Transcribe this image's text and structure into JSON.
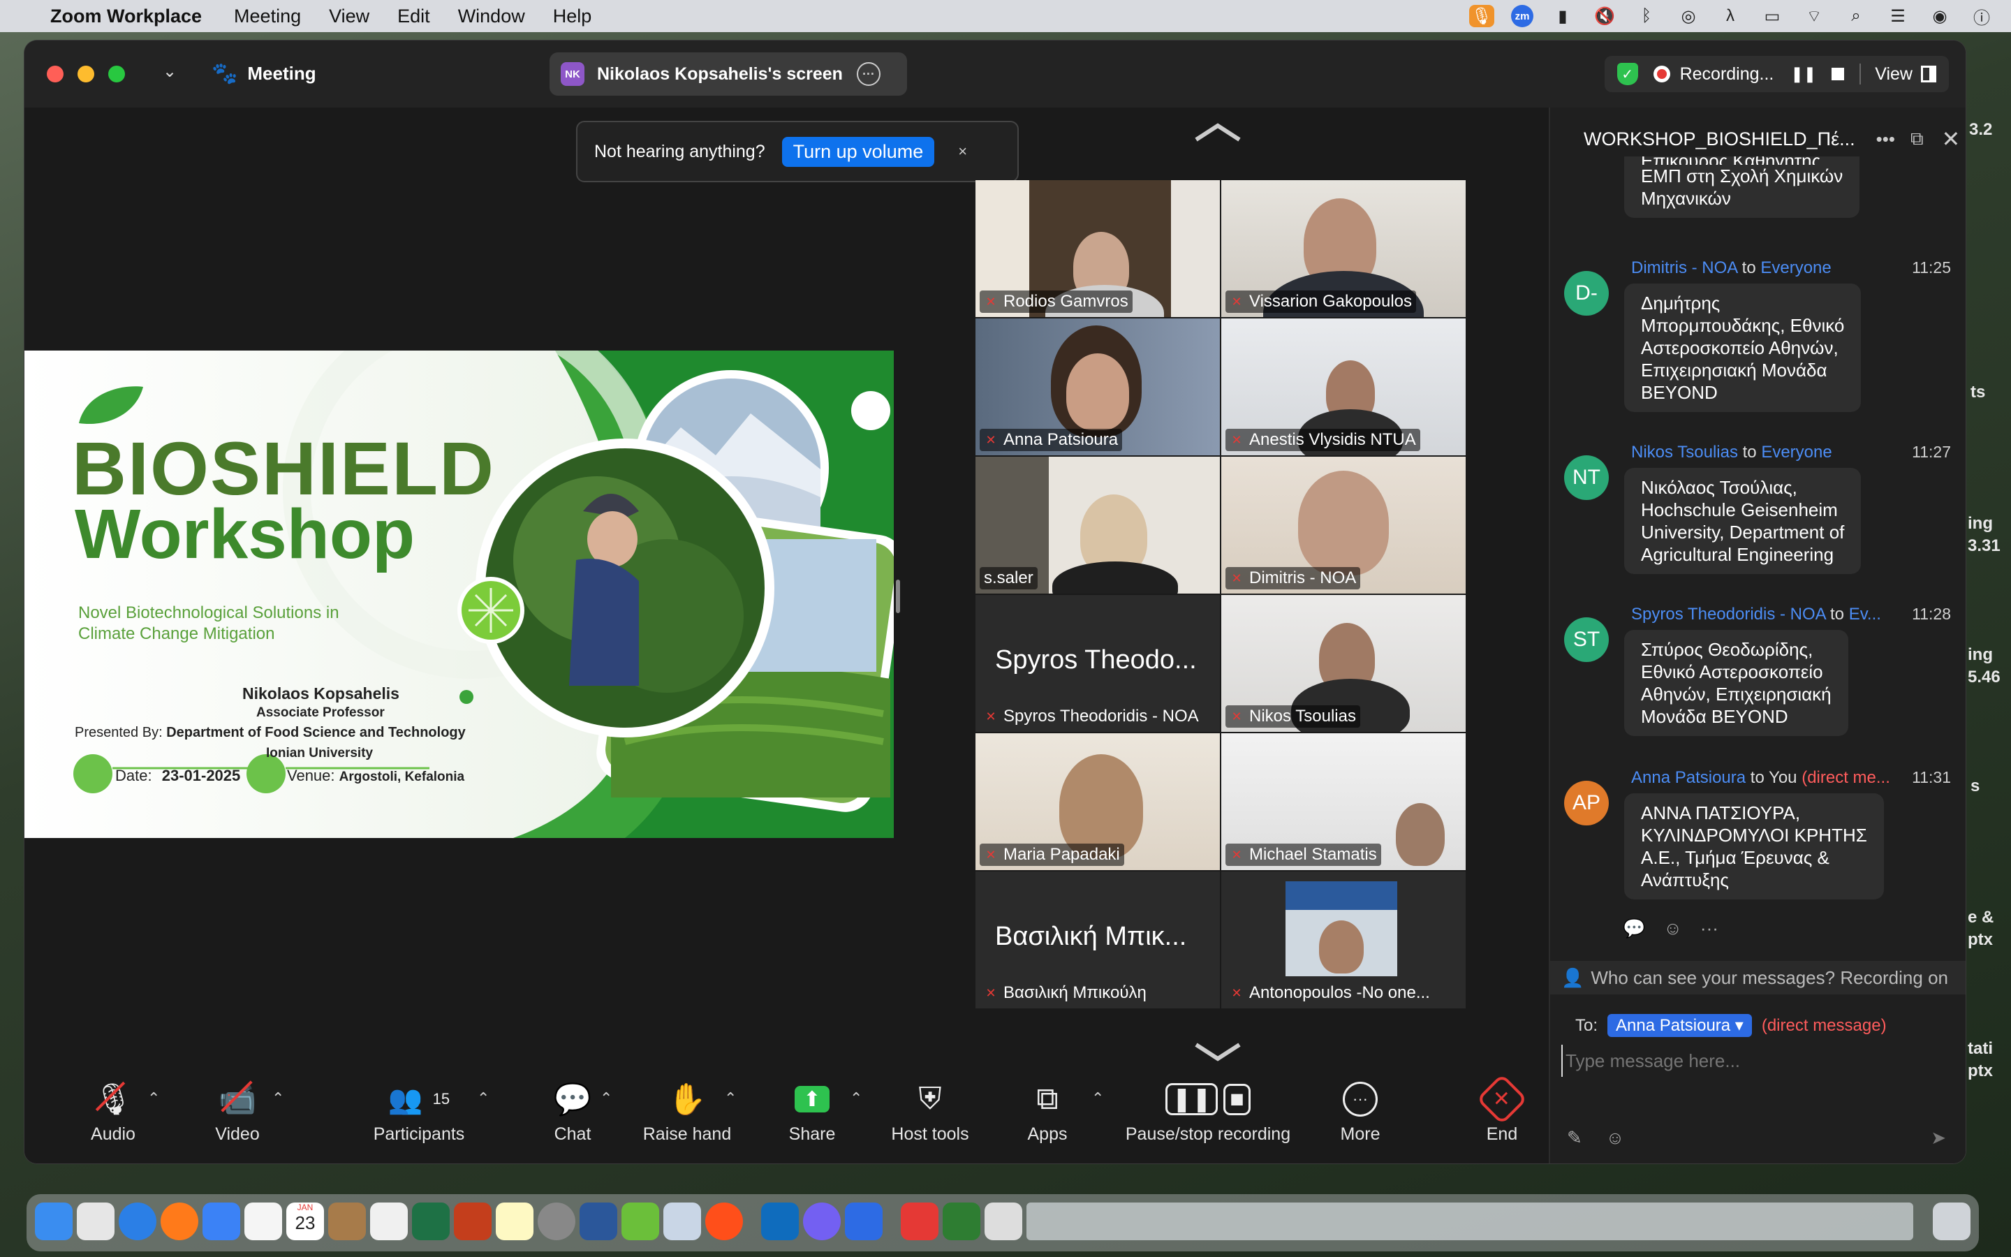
{
  "menubar": {
    "app": "Zoom Workplace",
    "items": [
      "Meeting",
      "View",
      "Edit",
      "Window",
      "Help"
    ]
  },
  "desktop_fragments": [
    "3.2",
    "ts",
    "ing",
    "3.31",
    "ing",
    "5.46",
    "s",
    "e &",
    "ptx",
    "tati",
    "ptx"
  ],
  "window": {
    "title": "Meeting",
    "screen_share_initials": "NK",
    "screen_share_label": "Nikolaos Kopsahelis's screen",
    "recording_label": "Recording...",
    "view_label": "View"
  },
  "banner": {
    "text": "Not hearing anything?",
    "button": "Turn up volume",
    "close": "×"
  },
  "slide": {
    "title_line1": "BIOSHIELD",
    "title_line2": "Workshop",
    "subtitle_line1": "Novel Biotechnological Solutions in",
    "subtitle_line2": "Climate Change Mitigation",
    "presenter": "Nikolaos Kopsahelis",
    "role": "Associate Professor",
    "presented_by_label": "Presented By:",
    "department": "Department of Food Science and Technology",
    "university": "Ionian University",
    "date_label": "Date:",
    "date": "23-01-2025",
    "venue_label": "Venue:",
    "venue": "Argostoli, Kefalonia"
  },
  "gallery": [
    {
      "name": "Rodios Gamvros",
      "muted": true
    },
    {
      "name": "Vissarion Gakopoulos",
      "muted": true
    },
    {
      "name": "Anna Patsioura",
      "muted": true
    },
    {
      "name": "Anestis Vlysidis NTUA",
      "muted": true
    },
    {
      "name": "s.saler",
      "muted": false
    },
    {
      "name": "Dimitris - NOA",
      "muted": true
    },
    {
      "name": "Spyros Theodoridis - NOA",
      "big": "Spyros Theodo...",
      "muted": true
    },
    {
      "name": "Nikos Tsoulias",
      "muted": true
    },
    {
      "name": "Maria Papadaki",
      "muted": true
    },
    {
      "name": "Michael Stamatis",
      "muted": true
    },
    {
      "name": "Βασιλική Μπικούλη",
      "big": "Βασιλική Μπικ...",
      "muted": true
    },
    {
      "name": "Antonopoulos -No one...",
      "muted": true
    }
  ],
  "chat": {
    "title": "WORKSHOP_BIOSHIELD_Πέ...",
    "partial_message": [
      "Επίκουρος Καθηγητής",
      "ΕΜΠ στη Σχολή Χημικών",
      "Μηχανικών"
    ],
    "messages": [
      {
        "initials": "D-",
        "sender": "Dimitris - NOA",
        "to_word": "to",
        "recipient": "Everyone",
        "time": "11:25",
        "color": "#2aa876",
        "lines": [
          "Δημήτρης",
          "Μπορμπουδάκης, Εθνικό",
          "Αστεροσκοπείο Αθηνών,",
          "Επιχειρησιακή Μονάδα",
          "BEYOND"
        ]
      },
      {
        "initials": "NT",
        "sender": "Nikos Tsoulias",
        "to_word": "to",
        "recipient": "Everyone",
        "time": "11:27",
        "color": "#2aa876",
        "lines": [
          "Νικόλαος Τσούλιας,",
          "Hochschule Geisenheim",
          "University, Department of",
          "Agricultural Engineering"
        ]
      },
      {
        "initials": "ST",
        "sender": "Spyros Theodoridis - NOA",
        "to_word": "to",
        "recipient": "Ev...",
        "time": "11:28",
        "color": "#2aa876",
        "lines": [
          "Σπύρος Θεοδωρίδης,",
          "Εθνικό Αστεροσκοπείο",
          "Αθηνών, Επιχειρησιακή",
          "Μονάδα BEYOND"
        ]
      },
      {
        "initials": "AP",
        "sender": "Anna Patsioura",
        "to_word": "to",
        "recipient": "You",
        "direct": "(direct me...",
        "time": "11:31",
        "color": "#e07a2a",
        "lines": [
          "ΑΝΝΑ ΠΑΤΣΙΟΥΡΑ,",
          "ΚΥΛΙΝΔΡΟΜΥΛΟΙ ΚΡΗΤΗΣ",
          "Α.Ε., Τμήμα Έρευνας &",
          "Ανάπτυξης"
        ]
      }
    ],
    "visibility_note": "Who can see your messages? Recording on",
    "to_label": "To:",
    "to_recipient": "Anna Patsioura",
    "to_direct": "(direct message)",
    "input_placeholder": "Type message here..."
  },
  "toolbar": {
    "audio": "Audio",
    "video": "Video",
    "participants": "Participants",
    "participants_count": "15",
    "chat": "Chat",
    "raise_hand": "Raise hand",
    "share": "Share",
    "host_tools": "Host tools",
    "apps": "Apps",
    "pause_stop": "Pause/stop recording",
    "more": "More",
    "end": "End"
  },
  "dock": {
    "calendar_month": "JAN",
    "calendar_day": "23"
  }
}
